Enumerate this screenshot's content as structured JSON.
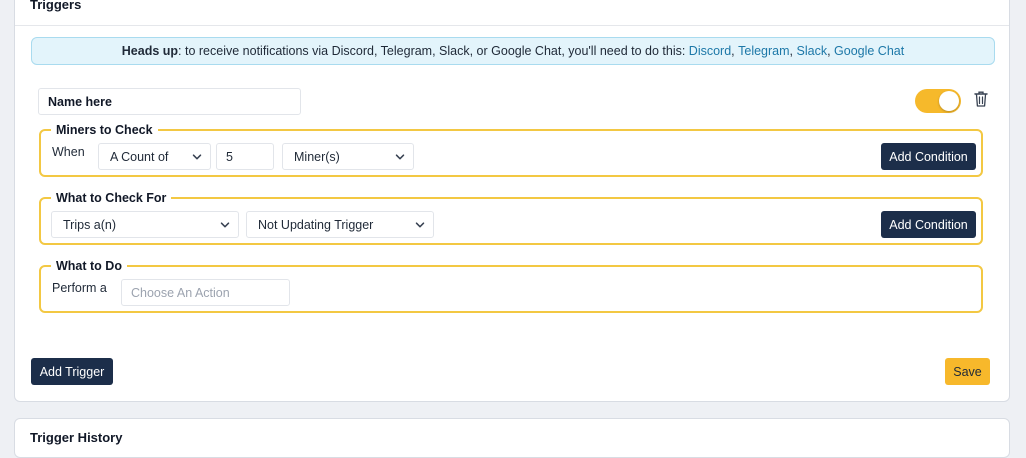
{
  "triggers_card": {
    "title": "Triggers"
  },
  "alert": {
    "prefix": "Heads up",
    "text": ": to receive notifications via Discord, Telegram, Slack, or Google Chat, you'll need to do this: ",
    "links": [
      "Discord",
      "Telegram",
      "Slack",
      "Google Chat"
    ],
    "separator": ", "
  },
  "trigger": {
    "name_value": "Name here",
    "enabled": true,
    "toggle_color": "#f6b92b",
    "miners": {
      "legend": "Miners to Check",
      "when_label": "When",
      "count_select": "A Count of",
      "count_value": "5",
      "unit_select": "Miner(s)",
      "add_condition": "Add Condition"
    },
    "check_for": {
      "legend": "What to Check For",
      "trips_select": "Trips a(n)",
      "trigger_select": "Not Updating Trigger",
      "add_condition": "Add Condition"
    },
    "todo": {
      "legend": "What to Do",
      "perform_label": "Perform a",
      "action_placeholder": "Choose An Action"
    }
  },
  "footer": {
    "add_trigger": "Add Trigger",
    "save": "Save"
  },
  "history_card": {
    "title": "Trigger History"
  }
}
